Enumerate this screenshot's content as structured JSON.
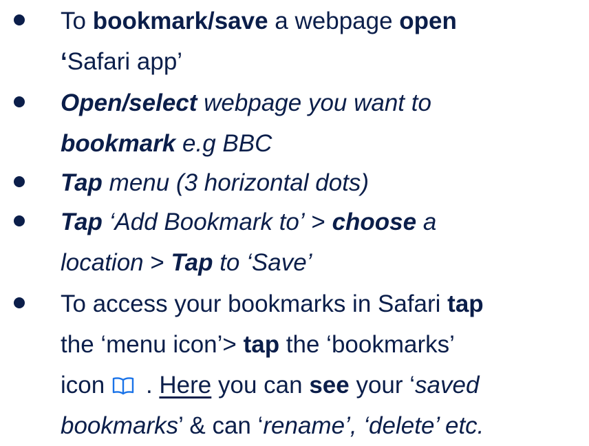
{
  "colors": {
    "text": "#0b1e4a",
    "background": "#ffffff"
  },
  "bullets": [
    {
      "line1": {
        "a": "To ",
        "b": "bookmark/save",
        "c": " a webpage ",
        "d": "open"
      },
      "line2": {
        "a": "‘",
        "b": "Safari app’"
      }
    },
    {
      "line1": {
        "a": "Open/select",
        "b": " webpage you want to"
      },
      "line2": {
        "a": "bookmark",
        "b": " e.g BBC"
      }
    },
    {
      "line1": {
        "a": "Tap",
        "b": " menu (3 horizontal dots)"
      }
    },
    {
      "line1": {
        "a": "Tap",
        "b": " ‘Add Bookmark to’",
        "c": " > ",
        "d": "choose",
        "e": " a"
      },
      "line2": {
        "a": "location",
        "b": " > ",
        "c": "Tap",
        "d": " to ‘Save’"
      }
    },
    {
      "line1": {
        "a": "To access your bookmarks in Safari ",
        "b": "tap"
      },
      "line2": {
        "a": "the ‘menu icon’> ",
        "b": "tap",
        "c": " the ‘bookmarks’"
      },
      "line3": {
        "a": "icon",
        "b": " . ",
        "c": "Here",
        "d": " you can ",
        "e": "see",
        "f": " your ‘",
        "g": "saved"
      },
      "line4": {
        "a": "bookmarks",
        "b": "’ & can ‘",
        "c": "rename’, ‘delete’ etc."
      }
    }
  ],
  "icons": {
    "bullet": "bullet-dot-icon",
    "bookmarks": "open-book-icon"
  }
}
